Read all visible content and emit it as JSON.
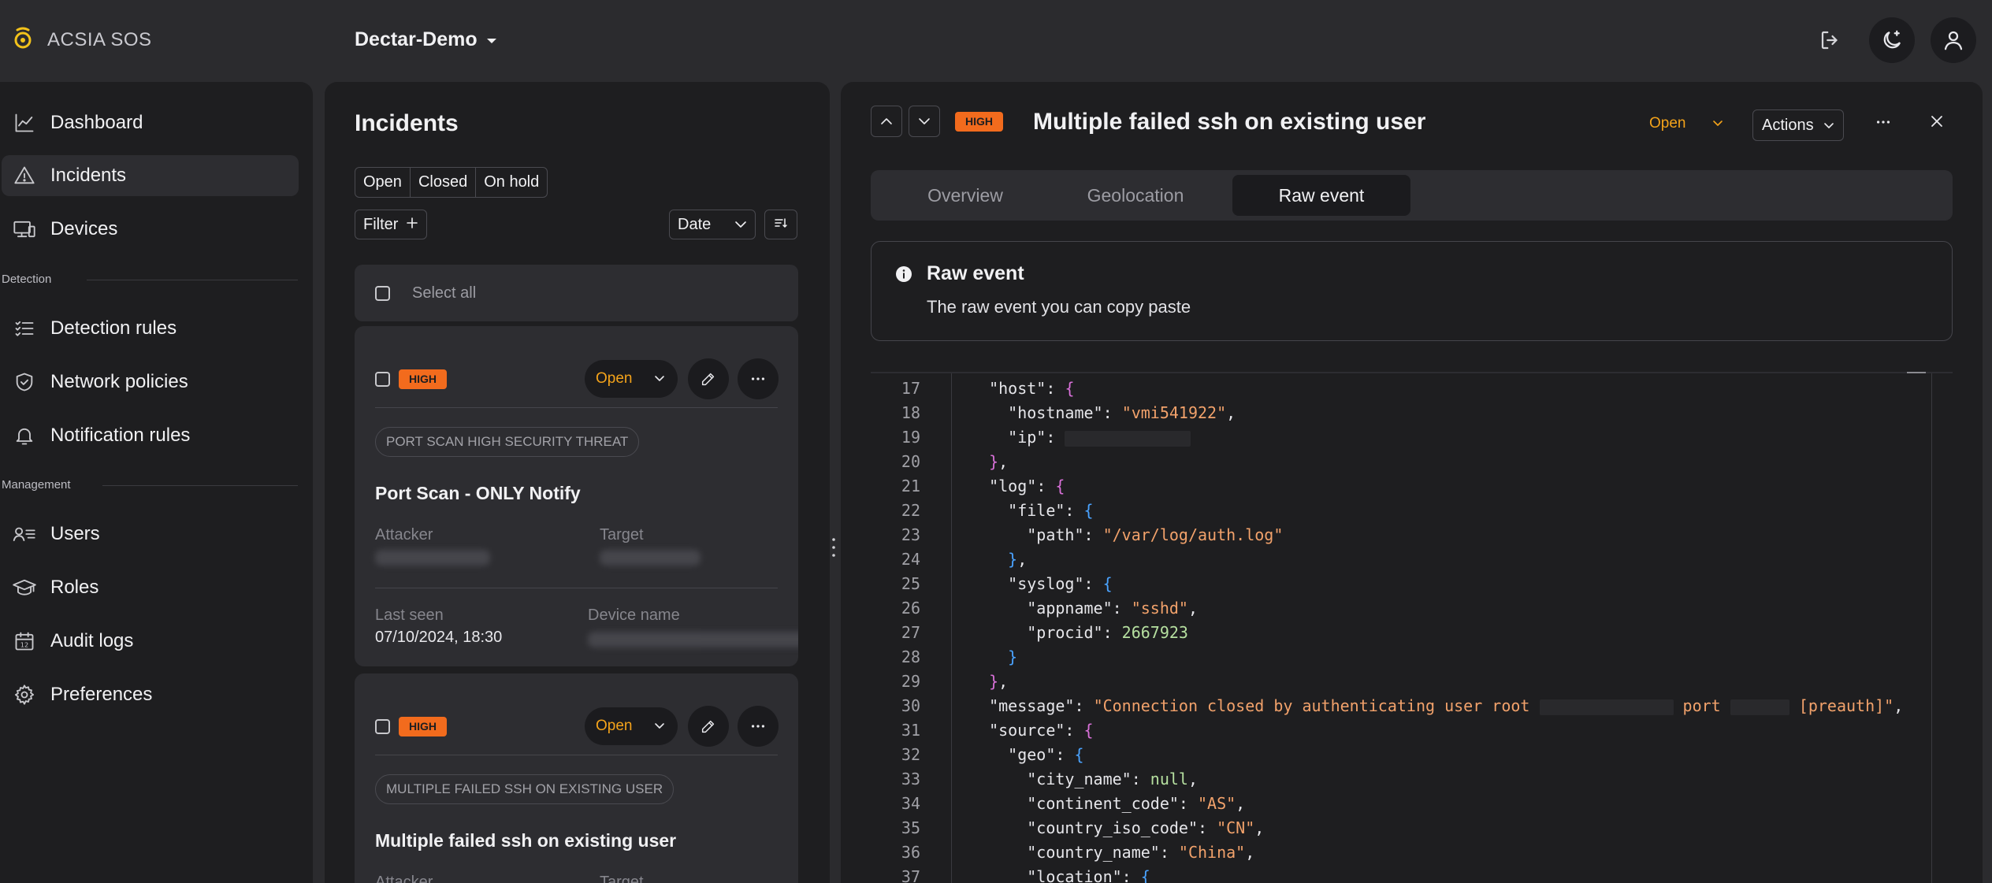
{
  "app": {
    "brand": "ACSIA SOS",
    "org": "Dectar-Demo"
  },
  "sidebar": {
    "items": [
      {
        "label": "Dashboard",
        "icon": "chart-line-icon"
      },
      {
        "label": "Incidents",
        "icon": "warning-triangle-icon"
      },
      {
        "label": "Devices",
        "icon": "devices-icon"
      },
      {
        "label": "Detection rules",
        "icon": "list-check-icon"
      },
      {
        "label": "Network policies",
        "icon": "shield-check-icon"
      },
      {
        "label": "Notification rules",
        "icon": "bell-icon"
      },
      {
        "label": "Users",
        "icon": "users-list-icon"
      },
      {
        "label": "Roles",
        "icon": "graduation-cap-icon"
      },
      {
        "label": "Audit logs",
        "icon": "calendar-icon"
      },
      {
        "label": "Preferences",
        "icon": "gear-icon"
      }
    ],
    "sections": {
      "detection": "Detection",
      "management": "Management"
    }
  },
  "incidents": {
    "title": "Incidents",
    "filters": [
      "Open",
      "Closed",
      "On hold"
    ],
    "filter_button": "Filter",
    "sort_field": "Date",
    "select_all": "Select all",
    "cards": [
      {
        "severity": "HIGH",
        "status": "Open",
        "tag": "PORT SCAN HIGH SECURITY THREAT",
        "title": "Port Scan - ONLY Notify",
        "attacker_label": "Attacker",
        "target_label": "Target",
        "last_seen_label": "Last seen",
        "last_seen": "07/10/2024, 18:30",
        "device_label": "Device name"
      },
      {
        "severity": "HIGH",
        "status": "Open",
        "tag": "MULTIPLE FAILED SSH ON EXISTING USER",
        "title": "Multiple failed ssh on existing user",
        "attacker_label": "Attacker",
        "target_label": "Target"
      }
    ]
  },
  "detail": {
    "severity": "HIGH",
    "title": "Multiple failed ssh on existing user",
    "status": "Open",
    "actions_label": "Actions",
    "tabs": [
      "Overview",
      "Geolocation",
      "Raw event"
    ],
    "active_tab": "Raw event",
    "info_title": "Raw event",
    "info_subtitle": "The raw event you can copy paste"
  },
  "code_lines": [
    {
      "n": "17",
      "parts": [
        [
          "p",
          "  "
        ],
        [
          "k",
          "\"host\""
        ],
        [
          "p",
          ": "
        ],
        [
          "b1",
          "{"
        ]
      ]
    },
    {
      "n": "18",
      "parts": [
        [
          "p",
          "    "
        ],
        [
          "k",
          "\"hostname\""
        ],
        [
          "p",
          ": "
        ],
        [
          "s",
          "\"vmi541922\""
        ],
        [
          "p",
          ","
        ]
      ]
    },
    {
      "n": "19",
      "parts": [
        [
          "p",
          "    "
        ],
        [
          "k",
          "\"ip\""
        ],
        [
          "p",
          ": "
        ],
        [
          "r",
          "160"
        ]
      ]
    },
    {
      "n": "20",
      "parts": [
        [
          "p",
          "  "
        ],
        [
          "b1",
          "}"
        ],
        [
          "p",
          ","
        ]
      ]
    },
    {
      "n": "21",
      "parts": [
        [
          "p",
          "  "
        ],
        [
          "k",
          "\"log\""
        ],
        [
          "p",
          ": "
        ],
        [
          "b1",
          "{"
        ]
      ]
    },
    {
      "n": "22",
      "parts": [
        [
          "p",
          "    "
        ],
        [
          "k",
          "\"file\""
        ],
        [
          "p",
          ": "
        ],
        [
          "b2",
          "{"
        ]
      ]
    },
    {
      "n": "23",
      "parts": [
        [
          "p",
          "      "
        ],
        [
          "k",
          "\"path\""
        ],
        [
          "p",
          ": "
        ],
        [
          "s",
          "\"/var/log/auth.log\""
        ]
      ]
    },
    {
      "n": "24",
      "parts": [
        [
          "p",
          "    "
        ],
        [
          "b2",
          "}"
        ],
        [
          "p",
          ","
        ]
      ]
    },
    {
      "n": "25",
      "parts": [
        [
          "p",
          "    "
        ],
        [
          "k",
          "\"syslog\""
        ],
        [
          "p",
          ": "
        ],
        [
          "b2",
          "{"
        ]
      ]
    },
    {
      "n": "26",
      "parts": [
        [
          "p",
          "      "
        ],
        [
          "k",
          "\"appname\""
        ],
        [
          "p",
          ": "
        ],
        [
          "s",
          "\"sshd\""
        ],
        [
          "p",
          ","
        ]
      ]
    },
    {
      "n": "27",
      "parts": [
        [
          "p",
          "      "
        ],
        [
          "k",
          "\"procid\""
        ],
        [
          "p",
          ": "
        ],
        [
          "n",
          "2667923"
        ]
      ]
    },
    {
      "n": "28",
      "parts": [
        [
          "p",
          "    "
        ],
        [
          "b2",
          "}"
        ]
      ]
    },
    {
      "n": "29",
      "parts": [
        [
          "p",
          "  "
        ],
        [
          "b1",
          "}"
        ],
        [
          "p",
          ","
        ]
      ]
    },
    {
      "n": "30",
      "parts": [
        [
          "p",
          "  "
        ],
        [
          "k",
          "\"message\""
        ],
        [
          "p",
          ": "
        ],
        [
          "s",
          "\"Connection closed by authenticating user root "
        ],
        [
          "r",
          "170"
        ],
        [
          "s",
          " port "
        ],
        [
          "r",
          "75"
        ],
        [
          "s",
          " [preauth]\""
        ],
        [
          "p",
          ","
        ]
      ]
    },
    {
      "n": "31",
      "parts": [
        [
          "p",
          "  "
        ],
        [
          "k",
          "\"source\""
        ],
        [
          "p",
          ": "
        ],
        [
          "b1",
          "{"
        ]
      ]
    },
    {
      "n": "32",
      "parts": [
        [
          "p",
          "    "
        ],
        [
          "k",
          "\"geo\""
        ],
        [
          "p",
          ": "
        ],
        [
          "b2",
          "{"
        ]
      ]
    },
    {
      "n": "33",
      "parts": [
        [
          "p",
          "      "
        ],
        [
          "k",
          "\"city_name\""
        ],
        [
          "p",
          ": "
        ],
        [
          "n",
          "null"
        ],
        [
          "p",
          ","
        ]
      ]
    },
    {
      "n": "34",
      "parts": [
        [
          "p",
          "      "
        ],
        [
          "k",
          "\"continent_code\""
        ],
        [
          "p",
          ": "
        ],
        [
          "s",
          "\"AS\""
        ],
        [
          "p",
          ","
        ]
      ]
    },
    {
      "n": "35",
      "parts": [
        [
          "p",
          "      "
        ],
        [
          "k",
          "\"country_iso_code\""
        ],
        [
          "p",
          ": "
        ],
        [
          "s",
          "\"CN\""
        ],
        [
          "p",
          ","
        ]
      ]
    },
    {
      "n": "36",
      "parts": [
        [
          "p",
          "      "
        ],
        [
          "k",
          "\"country_name\""
        ],
        [
          "p",
          ": "
        ],
        [
          "s",
          "\"China\""
        ],
        [
          "p",
          ","
        ]
      ]
    },
    {
      "n": "37",
      "parts": [
        [
          "p",
          "      "
        ],
        [
          "k",
          "\"location\""
        ],
        [
          "p",
          ": "
        ],
        [
          "b2",
          "{"
        ]
      ]
    }
  ],
  "colors": {
    "accent_orange": "#f26b1d",
    "status_open": "#f4a31a",
    "bg": "#2b2b2e",
    "panel": "#1e1e20"
  }
}
